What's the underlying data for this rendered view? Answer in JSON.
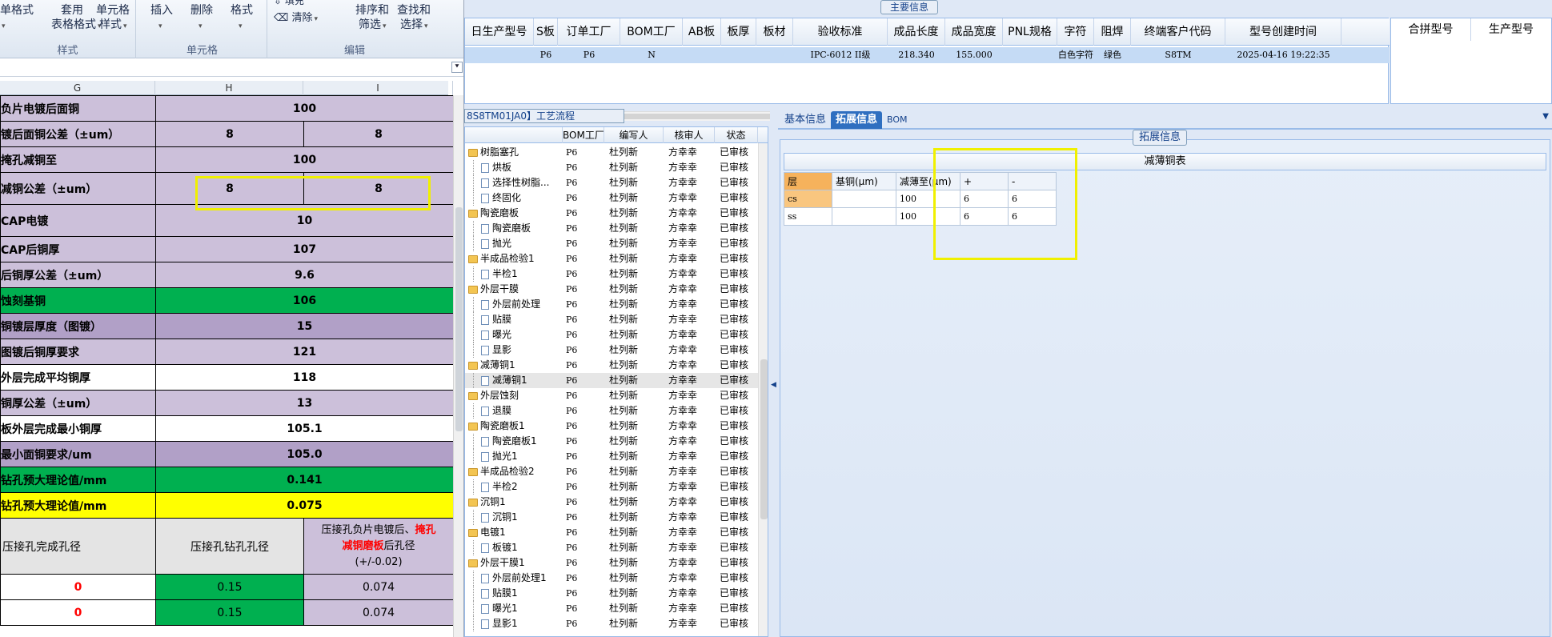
{
  "excel": {
    "ribbon": {
      "btn_cell_format": "单格式",
      "btn_apply": "套用",
      "btn_table_format": "表格格式",
      "btn_cell_style_1": "单元格",
      "btn_cell_style_2": "样式",
      "group_style": "样式",
      "btn_insert": "插入",
      "btn_delete": "删除",
      "btn_format": "格式",
      "group_cells": "单元格",
      "btn_fill": "填充",
      "btn_clear": "清除",
      "btn_sort_1": "排序和",
      "btn_sort_2": "筛选",
      "btn_find_1": "查找和",
      "btn_find_2": "选择",
      "group_edit": "编辑"
    },
    "columns": [
      "G",
      "H",
      "I"
    ],
    "rows": [
      {
        "label": "负片电镀后面铜",
        "h": "100",
        "i": "",
        "merged": true,
        "bg": "pur"
      },
      {
        "label": "镀后面铜公差（±um）",
        "h": "8",
        "i": "8",
        "merged": false,
        "bg": "pur"
      },
      {
        "label": "掩孔减铜至",
        "h": "100",
        "i": "",
        "merged": true,
        "bg": "pur"
      },
      {
        "label": "减铜公差（±um）",
        "h": "8",
        "i": "8",
        "merged": false,
        "bg": "pur"
      },
      {
        "label": "CAP电镀",
        "h": "10",
        "i": "",
        "merged": true,
        "bg": "pur"
      },
      {
        "label": "CAP后铜厚",
        "h": "107",
        "i": "",
        "merged": true,
        "bg": "pur"
      },
      {
        "label": "后铜厚公差（±um）",
        "h": "9.6",
        "i": "",
        "merged": true,
        "bg": "pur"
      },
      {
        "label": "蚀刻基铜",
        "h": "106",
        "i": "",
        "merged": true,
        "bg": "grn"
      },
      {
        "label": "铜镀层厚度（图镀）",
        "h": "15",
        "i": "",
        "merged": true,
        "bg": "pur2"
      },
      {
        "label": "图镀后铜厚要求",
        "h": "121",
        "i": "",
        "merged": true,
        "bg": "pur"
      },
      {
        "label": "外层完成平均铜厚",
        "h": "118",
        "i": "",
        "merged": true,
        "bg": "wht"
      },
      {
        "label": "铜厚公差（±um）",
        "h": "13",
        "i": "",
        "merged": true,
        "bg": "pur"
      },
      {
        "label": "板外层完成最小铜厚",
        "h": "105.1",
        "i": "",
        "merged": true,
        "bg": "wht"
      },
      {
        "label": "最小面铜要求/um",
        "h": "105.0",
        "i": "",
        "merged": true,
        "bg": "pur2"
      },
      {
        "label": "钻孔预大理论值/mm",
        "h": "0.141",
        "i": "",
        "merged": true,
        "bg": "grn"
      },
      {
        "label": "钻孔预大理论值/mm",
        "h": "0.075",
        "i": "",
        "merged": true,
        "bg": "ylw"
      }
    ],
    "hole_header": {
      "g": "压接孔完成孔径",
      "h": "压接孔钻孔孔径",
      "i_line1": "压接孔负片电镀后、",
      "i_red1": "掩孔",
      "i_red2": "减铜磨板",
      "i_line2_tail": "后孔径",
      "i_line3": "(+/-0.02)"
    },
    "hole_rows": [
      {
        "g": "0",
        "h": "0.15",
        "i": "0.074"
      },
      {
        "g": "0",
        "h": "0.15",
        "i": "0.074"
      }
    ]
  },
  "app": {
    "main_info_caption": "主要信息",
    "grid_headers": [
      "日生产型号",
      "S板",
      "订单工厂",
      "BOM工厂",
      "AB板",
      "板厚",
      "板材",
      "验收标准",
      "成品长度",
      "成品宽度",
      "PNL规格",
      "字符",
      "阻焊",
      "终端客户代码",
      "型号创建时间"
    ],
    "grid_row": [
      "",
      "P6",
      "P6",
      "N",
      "",
      "",
      "",
      "IPC-6012 II级",
      "218.340",
      "155.000",
      "",
      "白色字符",
      "绿色",
      "S8TM",
      "2025-04-16 19:22:35"
    ],
    "right_grid_headers": [
      "合拼型号",
      "生产型号"
    ],
    "process": {
      "caption": "8S8TM01JA0】工艺流程",
      "headers": [
        "",
        "BOM工厂",
        "编写人",
        "核审人",
        "状态"
      ],
      "rows": [
        {
          "name": "树脂塞孔",
          "folder": true,
          "bom": "P6",
          "writer": "杜列新",
          "reviewer": "方幸幸",
          "status": "已审核"
        },
        {
          "name": "烘板",
          "folder": false,
          "bom": "P6",
          "writer": "杜列新",
          "reviewer": "方幸幸",
          "status": "已审核"
        },
        {
          "name": "选择性树脂...",
          "folder": false,
          "bom": "P6",
          "writer": "杜列新",
          "reviewer": "方幸幸",
          "status": "已审核"
        },
        {
          "name": "终固化",
          "folder": false,
          "bom": "P6",
          "writer": "杜列新",
          "reviewer": "方幸幸",
          "status": "已审核"
        },
        {
          "name": "陶瓷磨板",
          "folder": true,
          "bom": "P6",
          "writer": "杜列新",
          "reviewer": "方幸幸",
          "status": "已审核"
        },
        {
          "name": "陶瓷磨板",
          "folder": false,
          "bom": "P6",
          "writer": "杜列新",
          "reviewer": "方幸幸",
          "status": "已审核"
        },
        {
          "name": "抛光",
          "folder": false,
          "bom": "P6",
          "writer": "杜列新",
          "reviewer": "方幸幸",
          "status": "已审核"
        },
        {
          "name": "半成品检验1",
          "folder": true,
          "bom": "P6",
          "writer": "杜列新",
          "reviewer": "方幸幸",
          "status": "已审核"
        },
        {
          "name": "半检1",
          "folder": false,
          "bom": "P6",
          "writer": "杜列新",
          "reviewer": "方幸幸",
          "status": "已审核"
        },
        {
          "name": "外层干膜",
          "folder": true,
          "bom": "P6",
          "writer": "杜列新",
          "reviewer": "方幸幸",
          "status": "已审核"
        },
        {
          "name": "外层前处理",
          "folder": false,
          "bom": "P6",
          "writer": "杜列新",
          "reviewer": "方幸幸",
          "status": "已审核"
        },
        {
          "name": "贴膜",
          "folder": false,
          "bom": "P6",
          "writer": "杜列新",
          "reviewer": "方幸幸",
          "status": "已审核"
        },
        {
          "name": "曝光",
          "folder": false,
          "bom": "P6",
          "writer": "杜列新",
          "reviewer": "方幸幸",
          "status": "已审核"
        },
        {
          "name": "显影",
          "folder": false,
          "bom": "P6",
          "writer": "杜列新",
          "reviewer": "方幸幸",
          "status": "已审核"
        },
        {
          "name": "减薄铜1",
          "folder": true,
          "bom": "P6",
          "writer": "杜列新",
          "reviewer": "方幸幸",
          "status": "已审核"
        },
        {
          "name": "减薄铜1",
          "folder": false,
          "bom": "P6",
          "writer": "杜列新",
          "reviewer": "方幸幸",
          "status": "已审核",
          "selected": true
        },
        {
          "name": "外层蚀刻",
          "folder": true,
          "bom": "P6",
          "writer": "杜列新",
          "reviewer": "方幸幸",
          "status": "已审核"
        },
        {
          "name": "退膜",
          "folder": false,
          "bom": "P6",
          "writer": "杜列新",
          "reviewer": "方幸幸",
          "status": "已审核"
        },
        {
          "name": "陶瓷磨板1",
          "folder": true,
          "bom": "P6",
          "writer": "杜列新",
          "reviewer": "方幸幸",
          "status": "已审核"
        },
        {
          "name": "陶瓷磨板1",
          "folder": false,
          "bom": "P6",
          "writer": "杜列新",
          "reviewer": "方幸幸",
          "status": "已审核"
        },
        {
          "name": "抛光1",
          "folder": false,
          "bom": "P6",
          "writer": "杜列新",
          "reviewer": "方幸幸",
          "status": "已审核"
        },
        {
          "name": "半成品检验2",
          "folder": true,
          "bom": "P6",
          "writer": "杜列新",
          "reviewer": "方幸幸",
          "status": "已审核"
        },
        {
          "name": "半检2",
          "folder": false,
          "bom": "P6",
          "writer": "杜列新",
          "reviewer": "方幸幸",
          "status": "已审核"
        },
        {
          "name": "沉铜1",
          "folder": true,
          "bom": "P6",
          "writer": "杜列新",
          "reviewer": "方幸幸",
          "status": "已审核"
        },
        {
          "name": "沉铜1",
          "folder": false,
          "bom": "P6",
          "writer": "杜列新",
          "reviewer": "方幸幸",
          "status": "已审核"
        },
        {
          "name": "电镀1",
          "folder": true,
          "bom": "P6",
          "writer": "杜列新",
          "reviewer": "方幸幸",
          "status": "已审核"
        },
        {
          "name": "板镀1",
          "folder": false,
          "bom": "P6",
          "writer": "杜列新",
          "reviewer": "方幸幸",
          "status": "已审核"
        },
        {
          "name": "外层干膜1",
          "folder": true,
          "bom": "P6",
          "writer": "杜列新",
          "reviewer": "方幸幸",
          "status": "已审核"
        },
        {
          "name": "外层前处理1",
          "folder": false,
          "bom": "P6",
          "writer": "杜列新",
          "reviewer": "方幸幸",
          "status": "已审核"
        },
        {
          "name": "贴膜1",
          "folder": false,
          "bom": "P6",
          "writer": "杜列新",
          "reviewer": "方幸幸",
          "status": "已审核"
        },
        {
          "name": "曝光1",
          "folder": false,
          "bom": "P6",
          "writer": "杜列新",
          "reviewer": "方幸幸",
          "status": "已审核"
        },
        {
          "name": "显影1",
          "folder": false,
          "bom": "P6",
          "writer": "杜列新",
          "reviewer": "方幸幸",
          "status": "已审核"
        }
      ]
    },
    "tabs": [
      "基本信息",
      "拓展信息",
      "BOM"
    ],
    "active_tab": 1,
    "ext_caption": "拓展信息",
    "copper_table": {
      "title": "减薄铜表",
      "headers": [
        "层",
        "基铜(μm)",
        "减薄至(μm)",
        "+",
        "-"
      ],
      "rows": [
        [
          "cs",
          "",
          "100",
          "6",
          "6"
        ],
        [
          "ss",
          "",
          "100",
          "6",
          "6"
        ]
      ]
    }
  },
  "colors": {
    "purple": "#ccc0da",
    "green": "#00b050",
    "yellow": "#ffff00",
    "highlight": "#f0f000",
    "tab_active": "#2f6fc0"
  }
}
